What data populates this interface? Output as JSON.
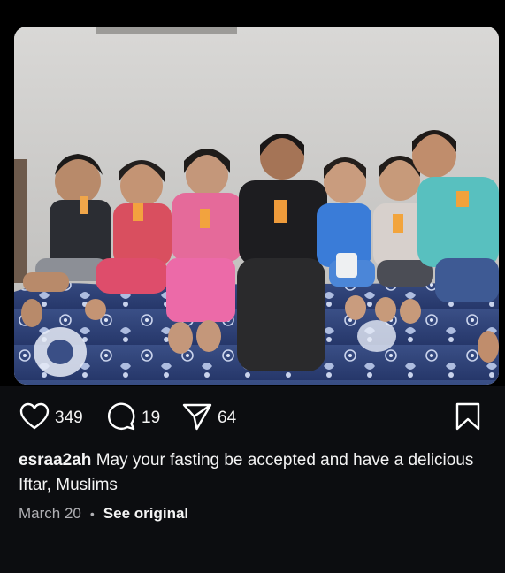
{
  "post": {
    "username": "esraa2ah",
    "caption": "May your fasting be accepted and have a delicious Iftar, Muslims",
    "date": "March 20",
    "separator": "•",
    "see_original": "See original"
  },
  "actions": {
    "likes": "349",
    "comments": "19",
    "shares": "64"
  },
  "icons": {
    "like": "heart-icon",
    "comment": "comment-bubble-icon",
    "share": "paper-plane-icon",
    "save": "bookmark-icon"
  },
  "colors": {
    "background": "#000000",
    "panel": "#0c0d10",
    "text": "#f4f4f4",
    "muted": "#b0b0b4"
  }
}
